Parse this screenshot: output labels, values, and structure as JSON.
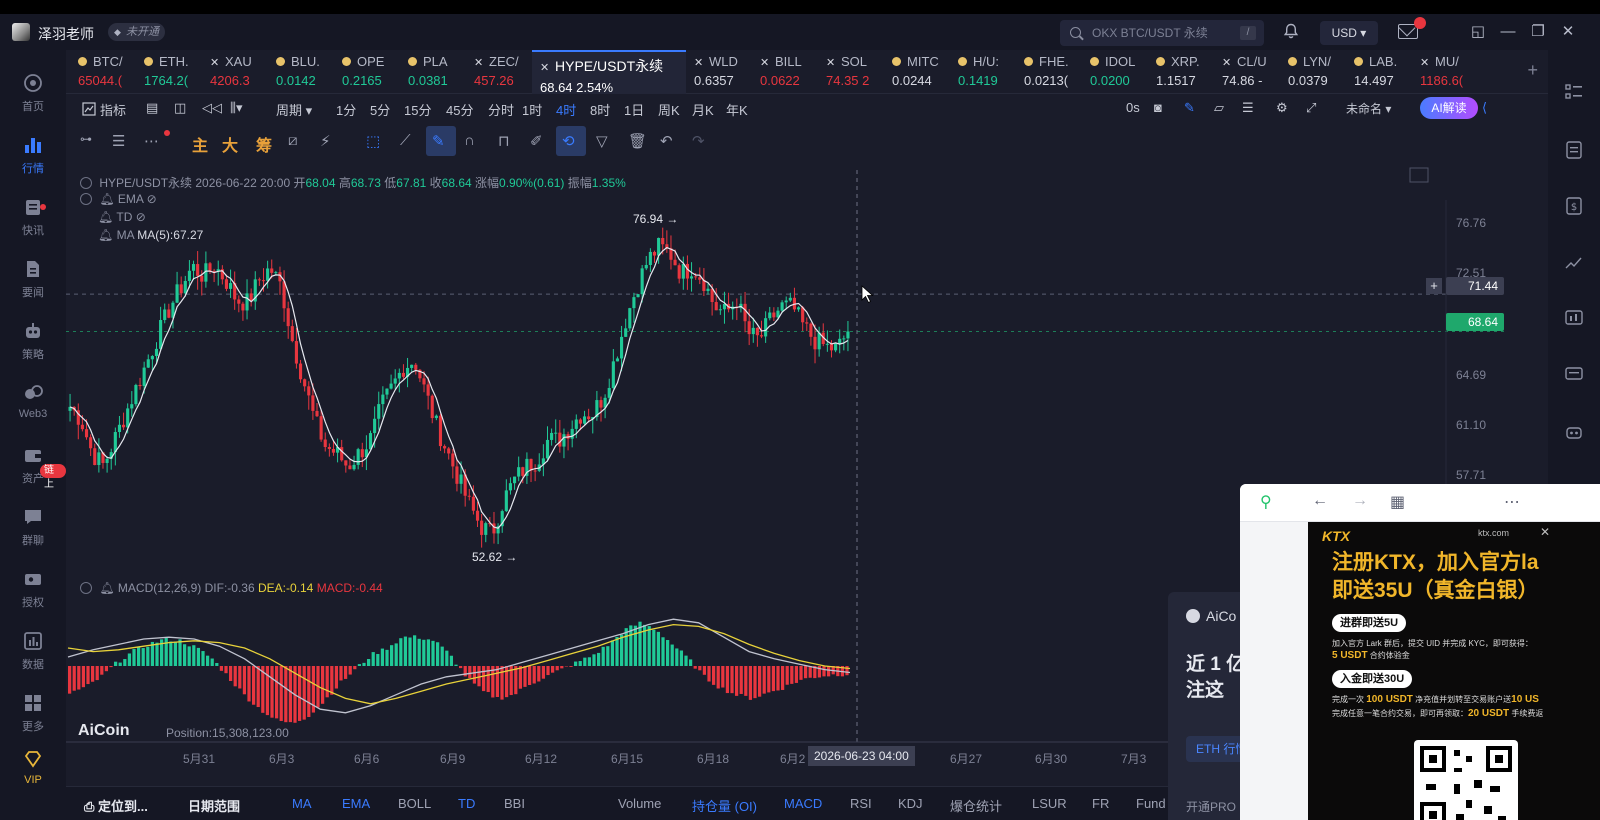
{
  "titlebar": {
    "user": "泽羽老师",
    "vip_badge": "未开通",
    "search_placeholder": "OKX BTC/USDT 永续",
    "search_shortcut": "/",
    "currency": "USD ▾"
  },
  "sidebar": {
    "items": [
      {
        "label": "首页",
        "icon": "home-icon"
      },
      {
        "label": "行情",
        "icon": "market-icon"
      },
      {
        "label": "快讯",
        "icon": "news-icon"
      },
      {
        "label": "要闻",
        "icon": "headline-icon"
      },
      {
        "label": "策略",
        "icon": "robot-icon"
      },
      {
        "label": "Web3",
        "icon": "web3-icon"
      },
      {
        "label": "资产",
        "icon": "wallet-icon"
      },
      {
        "label": "群聊",
        "icon": "chat-icon"
      },
      {
        "label": "授权",
        "icon": "key-icon"
      },
      {
        "label": "数据",
        "icon": "data-icon"
      },
      {
        "label": "更多",
        "icon": "grid-icon"
      },
      {
        "label": "VIP",
        "icon": "vip-icon"
      }
    ],
    "chain_badge": "链上"
  },
  "tickers": [
    {
      "name": "BTC/",
      "price": "65044.(",
      "color": "#e8363f",
      "mark": "coin"
    },
    {
      "name": "ETH.",
      "price": "1764.2(",
      "color": "#20c997",
      "mark": "coin"
    },
    {
      "name": "XAU",
      "price": "4206.3",
      "color": "#e8363f",
      "mark": "cross"
    },
    {
      "name": "BLU.",
      "price": "0.0142",
      "color": "#20c997",
      "mark": "coin"
    },
    {
      "name": "OPE",
      "price": "0.2165",
      "color": "#20c997",
      "mark": "coin"
    },
    {
      "name": "PLA",
      "price": "0.0381",
      "color": "#20c997",
      "mark": "coin"
    },
    {
      "name": "ZEC/",
      "price": "457.26",
      "color": "#e8363f",
      "mark": "cross"
    },
    {
      "name": "HYPE/USDT永续",
      "price": "68.64  2.54%",
      "color": "#ffffff",
      "mark": "cross",
      "active": true
    },
    {
      "name": "WLD",
      "price": "0.6357",
      "color": "#d7d9e2",
      "mark": "cross"
    },
    {
      "name": "BILL",
      "price": "0.0622",
      "color": "#e8363f",
      "mark": "cross"
    },
    {
      "name": "SOL",
      "price": "74.35 2",
      "color": "#e8363f",
      "mark": "cross"
    },
    {
      "name": "MITC",
      "price": "0.0244",
      "color": "#d7d9e2",
      "mark": "coin"
    },
    {
      "name": "H/U:",
      "price": "0.1419",
      "color": "#20c997",
      "mark": "coin"
    },
    {
      "name": "FHE.",
      "price": "0.0213(",
      "color": "#d7d9e2",
      "mark": "coin"
    },
    {
      "name": "IDOL",
      "price": "0.0200",
      "color": "#20c997",
      "mark": "coin"
    },
    {
      "name": "XRP.",
      "price": "1.1517",
      "color": "#d7d9e2",
      "mark": "coin"
    },
    {
      "name": "CL/U",
      "price": "74.86 -",
      "color": "#d7d9e2",
      "mark": "cross"
    },
    {
      "name": "LYN/",
      "price": "0.0379",
      "color": "#d7d9e2",
      "mark": "coin"
    },
    {
      "name": "LAB.",
      "price": "14.497",
      "color": "#d7d9e2",
      "mark": "coin"
    },
    {
      "name": "MU/",
      "price": "1186.6(",
      "color": "#e8363f",
      "mark": "cross"
    }
  ],
  "periods": {
    "indicator_label": "指标",
    "period_label": "周期 ▾",
    "items": [
      "1分",
      "5分",
      "15分",
      "45分",
      "分时",
      "1时",
      "4时",
      "8时",
      "1日",
      "周K",
      "月K",
      "年K"
    ],
    "active": "4时",
    "countdown": "0s",
    "unnamed": "未命名 ▾",
    "ai_button": "AI解读"
  },
  "drawbar": {
    "labels": [
      "主",
      "大",
      "筹"
    ]
  },
  "chart": {
    "legend": {
      "symbol": "HYPE/USDT永续",
      "datetime": "2026-06-22 20:00",
      "open_label": "开",
      "open": "68.04",
      "high_label": "高",
      "high": "68.73",
      "low_label": "低",
      "low": "67.81",
      "close_label": "收",
      "close": "68.64",
      "change_label": "涨幅",
      "change": "0.90%(0.61)",
      "amp_label": "振幅",
      "amp": "1.35%"
    },
    "ema_label": "EMA",
    "td_label": "TD",
    "ma_label": "MA",
    "ma_value": "MA(5):67.27",
    "macd_label": "MACD(12,26,9)",
    "dif": "DIF:-0.36",
    "dea": "DEA:-0.14",
    "macd": "MACD:-0.44",
    "high_mark": "76.94 →",
    "low_mark": "52.62 →",
    "crosshair_price": "71.44",
    "last_price": "68.64",
    "crosshair_time": "2026-06-23 04:00",
    "watermark": "AiCoin",
    "position": "Position:15,308,123.00",
    "yaxis": [
      "76.76",
      "72.51",
      "64.69",
      "61.10",
      "57.71"
    ],
    "xaxis": [
      "5月31",
      "6月3",
      "6月6",
      "6月9",
      "6月12",
      "6月15",
      "6月18",
      "6月2",
      "6月27",
      "6月30",
      "7月3"
    ]
  },
  "chart_data": {
    "type": "candlestick",
    "interval": "4时",
    "x_start": "5月30",
    "x_end": "6月23",
    "price_series": [
      63.0,
      62.0,
      59.5,
      58.6,
      60.5,
      62.5,
      64.5,
      66.5,
      68.5,
      70.5,
      72.0,
      73.5,
      72.8,
      73.6,
      72.5,
      71.0,
      70.8,
      72.5,
      73.4,
      72.0,
      68.0,
      65.0,
      62.0,
      60.0,
      59.5,
      58.5,
      59.5,
      60.5,
      63.0,
      64.5,
      66.0,
      66.5,
      64.0,
      61.5,
      59.5,
      57.5,
      55.5,
      54.0,
      53.5,
      56.0,
      57.5,
      58.5,
      59.0,
      60.5,
      60.5,
      61.5,
      62.5,
      62.5,
      63.8,
      66.5,
      69.5,
      72.0,
      74.0,
      75.0,
      74.5,
      73.0,
      73.5,
      72.5,
      70.5,
      70.0,
      71.0,
      68.5,
      68.0,
      69.5,
      70.5,
      70.5,
      69.0,
      68.0,
      67.5,
      67.3,
      68.6
    ],
    "high": 76.94,
    "low": 52.62,
    "last": 68.64,
    "y_ticks": [
      76.76,
      72.51,
      64.69,
      61.1,
      57.71
    ],
    "macd": {
      "dif": -0.36,
      "dea": -0.14,
      "macd": -0.44,
      "hist": [
        -1.5,
        -1.2,
        -0.6,
        0.2,
        0.8,
        1.2,
        1.5,
        1.4,
        1.0,
        0.4,
        -0.6,
        -1.6,
        -2.4,
        -3.0,
        -3.2,
        -2.8,
        -2.0,
        -1.0,
        -0.2,
        0.6,
        1.0,
        1.6,
        1.6,
        1.4,
        0.6,
        -0.6,
        -1.4,
        -1.8,
        -1.6,
        -1.0,
        -0.6,
        -0.2,
        0.2,
        0.6,
        1.2,
        2.0,
        2.4,
        2.0,
        1.2,
        0.4,
        -0.6,
        -1.2,
        -1.6,
        -1.8,
        -1.5,
        -1.2,
        -0.8,
        -0.6,
        -0.5,
        -0.44
      ],
      "dif_series": [
        0.5,
        0.9,
        1.2,
        1.5,
        1.6,
        1.5,
        1.1,
        0.4,
        -0.6,
        -1.6,
        -2.4,
        -2.6,
        -2.2,
        -1.6,
        -1.0,
        -0.6,
        -0.4,
        -0.2,
        0.2,
        0.6,
        1.0,
        1.4,
        1.8,
        2.3,
        2.6,
        2.4,
        1.6,
        0.8,
        0.4,
        0.1,
        -0.2,
        -0.36
      ],
      "dea_series": [
        1.0,
        0.8,
        0.9,
        1.1,
        1.3,
        1.4,
        1.3,
        1.0,
        0.4,
        -0.4,
        -1.2,
        -1.8,
        -2.1,
        -1.8,
        -1.4,
        -1.0,
        -0.7,
        -0.4,
        -0.1,
        0.3,
        0.7,
        1.1,
        1.6,
        2.0,
        2.3,
        2.2,
        1.8,
        1.2,
        0.7,
        0.3,
        0.0,
        -0.14
      ]
    }
  },
  "bottombar": {
    "locate": "定位到...",
    "range": "日期范围",
    "indicators": [
      "MA",
      "EMA",
      "BOLL",
      "TD",
      "BBI",
      "Volume",
      "持仓量 (OI)",
      "MACD",
      "RSI",
      "KDJ",
      "爆仓统计",
      "LSUR",
      "FR",
      "Fund"
    ]
  },
  "news_card": {
    "brand": "AiCo",
    "headline": "近 1 亿 押注这",
    "eth_button": "ETH 行情",
    "open_pro": "开通PRO"
  },
  "popup": {
    "ad_brand": "KTX",
    "ad_domain": "ktx.com",
    "ad_title_1": "注册KTX，加入官方la",
    "ad_title_2": "即送35U（真金白银）",
    "pill_1": "进群即送5U",
    "line_1_pre": "加入官方 Lark 群后，提交 UID 并完成 KYC，即可获得：",
    "line_1_amount": "5 USDT",
    "line_1_post": " 合约体验金",
    "pill_2": "入金即送30U",
    "line_2_pre": "完成一次 ",
    "line_2_amount": "100 USDT",
    "line_2_post": " 净充值并划转至交易账户送",
    "line_2_amount2": "10 US",
    "line_3_pre": "完成任意一笔合约交易，即可再领取：",
    "line_3_amount": "20 USDT",
    "line_3_post": " 手续费返"
  },
  "colors": {
    "up": "#20c997",
    "down": "#e8363f",
    "accent": "#3a7bff",
    "dea_line": "#e8d23a"
  }
}
